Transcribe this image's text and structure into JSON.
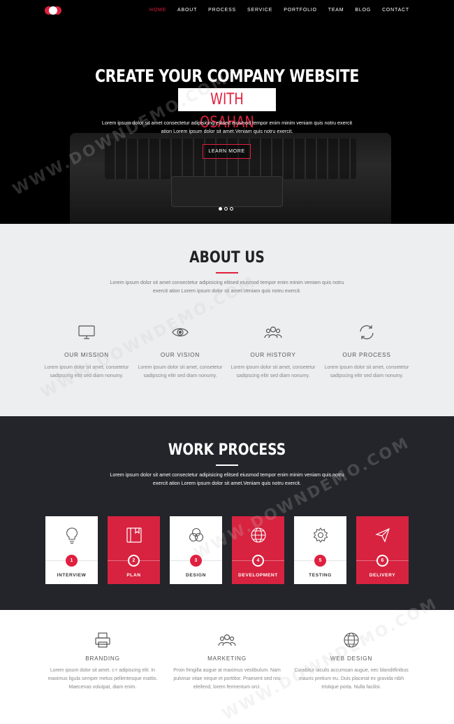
{
  "nav": {
    "items": [
      "HOME",
      "ABOUT",
      "PROCESS",
      "SERVICE",
      "PORTFOLIO",
      "TEAM",
      "BLOG",
      "CONTACT"
    ],
    "active": "HOME"
  },
  "hero": {
    "title": "CREATE YOUR COMPANY WEBSITE",
    "highlight": "WITH OSAHAN",
    "text": "Lorem ipsum dolor sit amet consectetur adipisicing elitsed eiusmod tempor enim minim veniam quis notru exercit ation Lorem ipsum dolor sit amet.Veniam quis notru exercit.",
    "button": "LEARN MORE",
    "slides": 3,
    "active_slide": 1
  },
  "about": {
    "title": "ABOUT US",
    "text": "Lorem ipsum dolor sit amet consectetur adipisicing elitsed eiusmod tempor enim minim veniam quis notru exercit ation Lorem ipsum dolor sit amet.Veniam quis notru exercit.",
    "features": [
      {
        "icon": "monitor-icon",
        "title": "OUR MISSION",
        "text": "Lorem ipsum dolor sit amet, consetetur sadipscing elitr sed diam nonumy."
      },
      {
        "icon": "eye-icon",
        "title": "OUR VISION",
        "text": "Lorem ipsum dolor sit amet, consetetur sadipscing elitr sed diam nonumy."
      },
      {
        "icon": "users-icon",
        "title": "OUR HISTORY",
        "text": "Lorem ipsum dolor sit amet, consetetur sadipscing elitr sed diam nonumy."
      },
      {
        "icon": "refresh-icon",
        "title": "OUR PROCESS",
        "text": "Lorem ipsum dolor sit amet, consetetur sadipscing elitr sed diam nonumy."
      }
    ]
  },
  "work": {
    "title": "WORK PROCESS",
    "text": "Lorem ipsum dolor sit amet consectetur adipisicing elitsed eiusmod tempor enim minim veniam quis notru exercit ation Lorem ipsum dolor sit amet.Veniam quis notru exercit.",
    "steps": [
      {
        "num": "1",
        "label": "INTERVIEW",
        "icon": "lightbulb-icon"
      },
      {
        "num": "2",
        "label": "PLAN",
        "icon": "book-icon"
      },
      {
        "num": "3",
        "label": "DESIGN",
        "icon": "circles-icon"
      },
      {
        "num": "4",
        "label": "DEVELOPMENT",
        "icon": "globe-icon"
      },
      {
        "num": "5",
        "label": "TESTING",
        "icon": "gear-icon"
      },
      {
        "num": "6",
        "label": "DELIVERY",
        "icon": "paper-plane-icon"
      }
    ]
  },
  "services": [
    {
      "icon": "printer-icon",
      "title": "BRANDING",
      "text": "Lorem ipsum dolor sit amet. c-r adipiscing elit. In maximus ligula semper metus pellentesque mattis. Maecenas volutpat, diam enim."
    },
    {
      "icon": "users-icon",
      "title": "MARKETING",
      "text": "Proin fringilla augue at maximus vestibulum. Nam pulvinar vitae neque et porttitor. Praesent sed nisi eleifend, lorem fermentum orci."
    },
    {
      "icon": "globe-icon",
      "title": "WEB DESIGN",
      "text": "Curabitur iaculis accumsan augue, nec blanditfinibus mauris pretium eu. Duis placerat ex gravida nibh tristique porta. Nulla facilisi."
    }
  ],
  "watermark": "WWW.DOWNDEMO.COM",
  "colors": {
    "accent": "#e0203f",
    "dark": "#23252a",
    "light": "#eceeef"
  }
}
